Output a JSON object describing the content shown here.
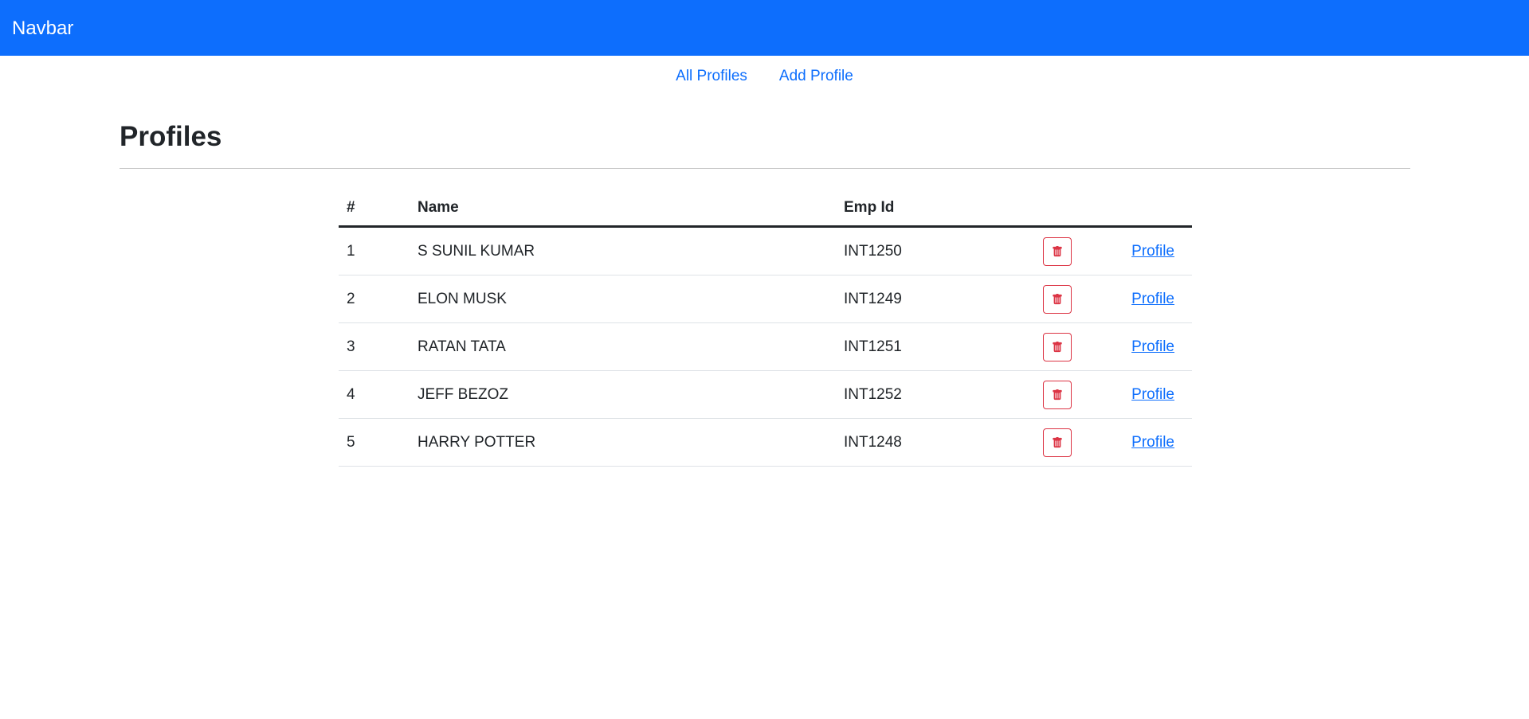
{
  "navbar": {
    "brand": "Navbar",
    "color": "#0d6efd"
  },
  "subnav": {
    "links": [
      {
        "label": "All Profiles"
      },
      {
        "label": "Add Profile"
      }
    ]
  },
  "page": {
    "title": "Profiles"
  },
  "table": {
    "headers": [
      "#",
      "Name",
      "Emp Id"
    ],
    "rows": [
      {
        "num": "1",
        "name": "S SUNIL KUMAR",
        "emp_id": "INT1250",
        "link": "Profile"
      },
      {
        "num": "2",
        "name": "ELON MUSK",
        "emp_id": "INT1249",
        "link": "Profile"
      },
      {
        "num": "3",
        "name": "RATAN TATA",
        "emp_id": "INT1251",
        "link": "Profile"
      },
      {
        "num": "4",
        "name": "JEFF BEZOZ",
        "emp_id": "INT1252",
        "link": "Profile"
      },
      {
        "num": "5",
        "name": "HARRY POTTER",
        "emp_id": "INT1248",
        "link": "Profile"
      }
    ],
    "delete_icon": "trash-icon",
    "delete_color": "#dc3545"
  }
}
